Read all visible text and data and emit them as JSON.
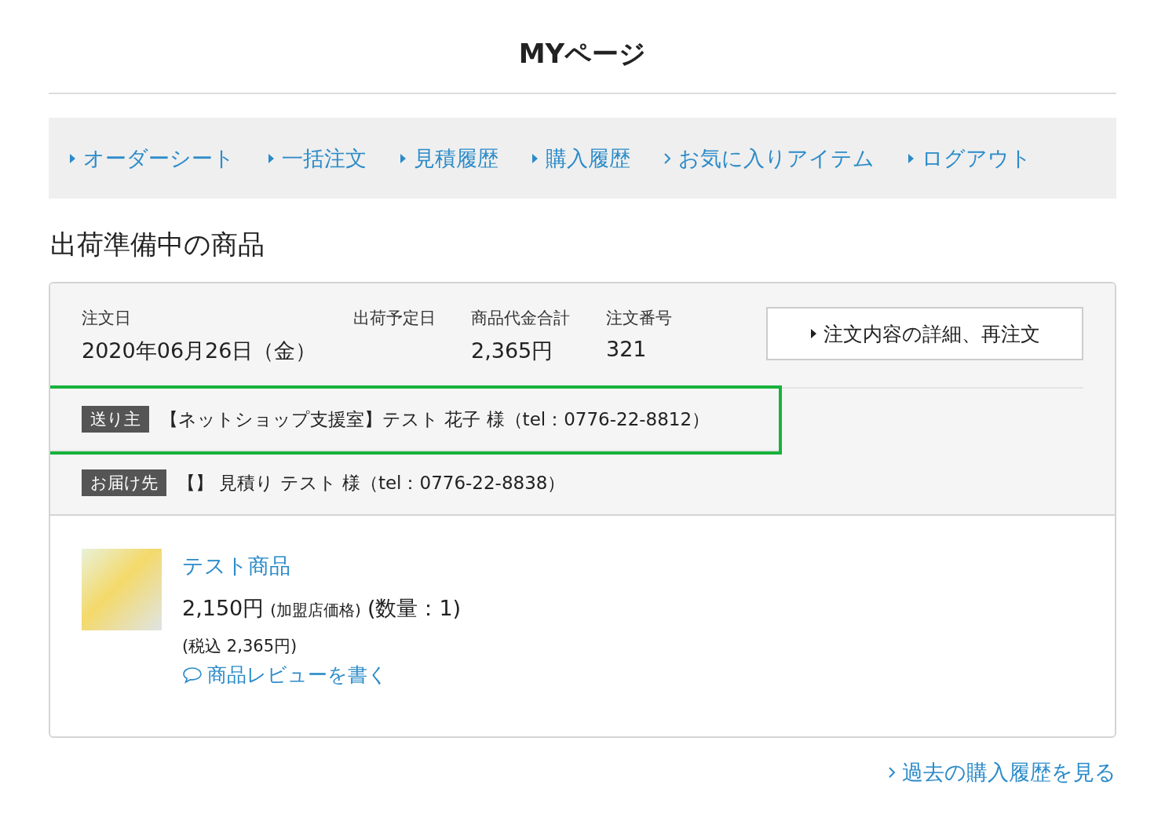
{
  "page_title": "MYページ",
  "nav": [
    {
      "label": "オーダーシート",
      "kind": "triangle"
    },
    {
      "label": "一括注文",
      "kind": "triangle"
    },
    {
      "label": "見積履歴",
      "kind": "triangle"
    },
    {
      "label": "購入履歴",
      "kind": "triangle"
    },
    {
      "label": "お気に入りアイテム",
      "kind": "chevron"
    },
    {
      "label": "ログアウト",
      "kind": "triangle"
    }
  ],
  "section_title": "出荷準備中の商品",
  "order": {
    "fields": [
      {
        "label": "注文日",
        "value": "2020年06月26日（金）"
      },
      {
        "label": "出荷予定日"
      },
      {
        "label": "商品代金合計",
        "value": "2,365円"
      },
      {
        "label": "注文番号",
        "value": "321"
      }
    ],
    "detail_button": "注文内容の詳細、再注文",
    "parties": [
      {
        "tag": "送り主",
        "text": "【ネットショップ支援室】テスト 花子 様（tel：0776-22-8812）",
        "highlighted": true
      },
      {
        "tag": "お届け先",
        "text": "【】 見積り テスト 様（tel：0776-22-8838）",
        "highlighted": false
      }
    ],
    "items": [
      {
        "name": "テスト商品",
        "price": "2,150円",
        "price_note": "(加盟店価格)",
        "quantity": "(数量：1)",
        "tax_included": "(税込 2,365円)",
        "review_link": "商品レビューを書く"
      }
    ]
  },
  "history_link": "過去の購入履歴を見る"
}
